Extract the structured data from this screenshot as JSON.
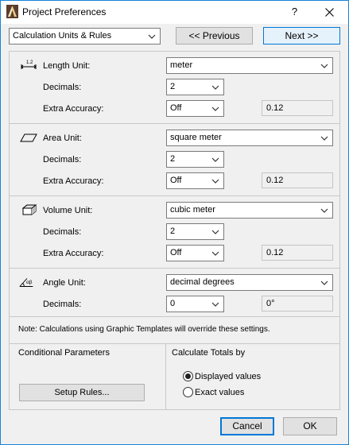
{
  "window": {
    "title": "Project Preferences",
    "help_label": "?",
    "close_label": "✕"
  },
  "header": {
    "category_select": "Calculation Units & Rules",
    "previous_label": "<< Previous",
    "next_label": "Next >>"
  },
  "length": {
    "label": "Length Unit:",
    "unit": "meter",
    "decimals_label": "Decimals:",
    "decimals": "2",
    "extra_label": "Extra Accuracy:",
    "extra": "Off",
    "preview": "0.12",
    "icon_text": "1.2"
  },
  "area": {
    "label": "Area Unit:",
    "unit": "square meter",
    "decimals_label": "Decimals:",
    "decimals": "2",
    "extra_label": "Extra Accuracy:",
    "extra": "Off",
    "preview": "0.12"
  },
  "volume": {
    "label": "Volume Unit:",
    "unit": "cubic meter",
    "decimals_label": "Decimals:",
    "decimals": "2",
    "extra_label": "Extra Accuracy:",
    "extra": "Off",
    "preview": "0.12"
  },
  "angle": {
    "label": "Angle Unit:",
    "unit": "decimal degrees",
    "decimals_label": "Decimals:",
    "decimals": "0",
    "preview": "0°",
    "icon_text": "αβ"
  },
  "note": "Note:  Calculations using Graphic Templates will override these settings.",
  "conditional": {
    "title": "Conditional Parameters",
    "setup_label": "Setup Rules..."
  },
  "totals": {
    "title": "Calculate Totals by",
    "options": [
      {
        "label": "Displayed values",
        "selected": true
      },
      {
        "label": "Exact values",
        "selected": false
      }
    ]
  },
  "footer": {
    "cancel_label": "Cancel",
    "ok_label": "OK"
  },
  "colors": {
    "accent": "#0078d7",
    "window_border": "#1883d7",
    "dialog_bg": "#f0f0f0"
  }
}
